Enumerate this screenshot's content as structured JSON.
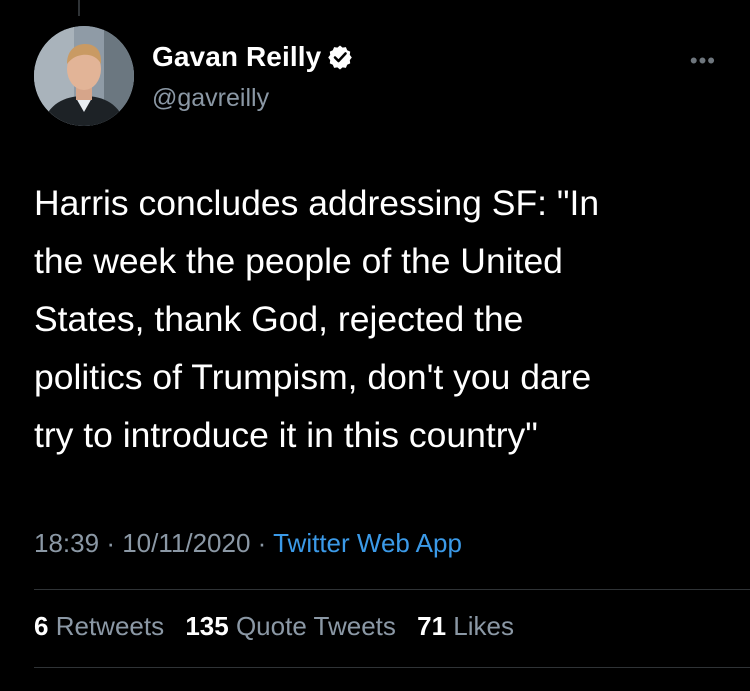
{
  "user": {
    "display_name": "Gavan Reilly",
    "handle": "@gavreilly",
    "verified": true,
    "avatar_icon": "profile-photo"
  },
  "menu_icon": "more-horizontal-icon",
  "tweet": {
    "text": "Harris concludes addressing SF: \"In\nthe week the people of the United\nStates, thank God, rejected the\npolitics of Trumpism, don't you dare\ntry to introduce it in this country\"",
    "time": "18:39",
    "date": "10/11/2020",
    "separator": "·",
    "source": "Twitter Web App"
  },
  "stats": {
    "retweets_count": "6",
    "retweets_label": "Retweets",
    "quote_tweets_count": "135",
    "quote_tweets_label": "Quote Tweets",
    "likes_count": "71",
    "likes_label": "Likes"
  },
  "colors": {
    "background": "#000000",
    "primary_text": "#ffffff",
    "secondary_text": "#8b98a5",
    "link": "#3b9ae8",
    "divider": "#2f3336"
  }
}
